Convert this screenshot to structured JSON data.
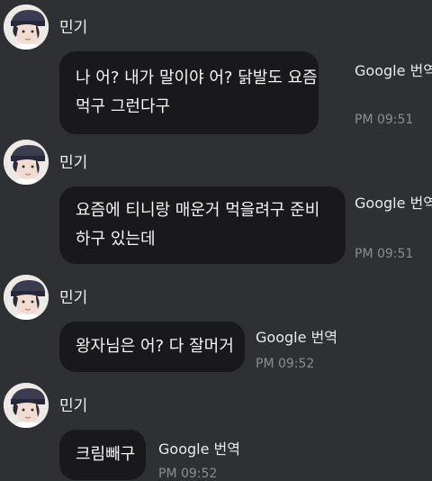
{
  "messages": [
    {
      "sender": "민기",
      "lines": [
        "나 어? 내가 말이야 어?  닭발도 요즘",
        "먹구 그런다구"
      ],
      "translate_label": "Google 번역",
      "time": "PM 09:51"
    },
    {
      "sender": "민기",
      "lines": [
        "요즘에 티니랑 매운거 먹을려구 준비",
        "하구 있는데"
      ],
      "translate_label": "Google 번역",
      "time": "PM 09:51"
    },
    {
      "sender": "민기",
      "lines": [
        "왕자님은 어? 다 잘머거"
      ],
      "translate_label": "Google 번역",
      "time": "PM 09:52"
    },
    {
      "sender": "민기",
      "lines": [
        "크림빼구"
      ],
      "translate_label": "Google 번역",
      "time": "PM 09:52"
    }
  ]
}
